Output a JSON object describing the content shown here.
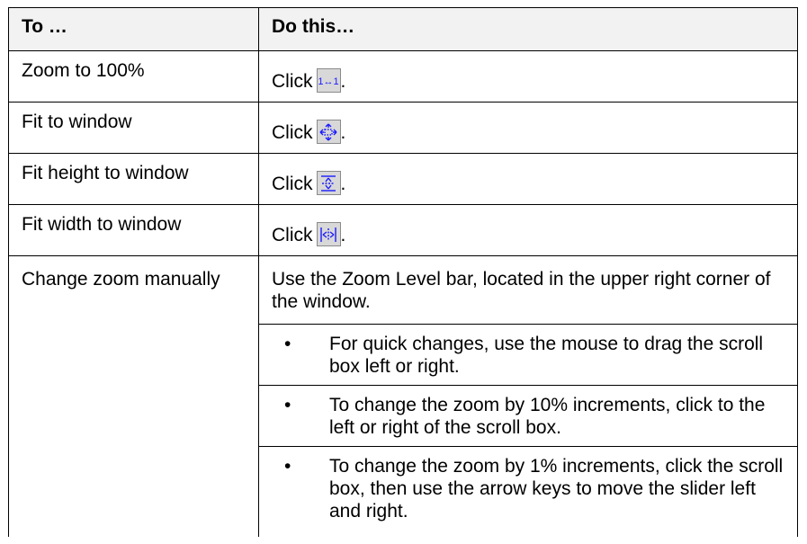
{
  "header": {
    "col1": "To …",
    "col2": "Do this…"
  },
  "rows": [
    {
      "action": "Zoom to 100%",
      "click_label": "Click",
      "icon": "zoom-100-icon",
      "period": "."
    },
    {
      "action": "Fit to window",
      "click_label": "Click",
      "icon": "fit-window-icon",
      "period": "."
    },
    {
      "action": "Fit height to window",
      "click_label": "Click",
      "icon": "fit-height-icon",
      "period": "."
    },
    {
      "action": "Fit width to window",
      "click_label": "Click",
      "icon": "fit-width-icon",
      "period": "."
    }
  ],
  "manual": {
    "action": "Change zoom manually",
    "intro": "Use the Zoom Level bar, located in the upper right corner of the window.",
    "bullets": [
      "For quick changes, use the mouse to drag the scroll box left or right.",
      "To change the zoom by 10% increments, click to the left or right of the scroll box.",
      "To change the zoom by 1% increments, click the scroll box, then use the arrow keys to move the slider left and right."
    ]
  },
  "icon_text": {
    "zoom_100": "1↔1"
  },
  "colors": {
    "icon_blue": "#1a1aff",
    "button_bg": "#d8d8d8",
    "header_bg": "#f2f2f2"
  }
}
